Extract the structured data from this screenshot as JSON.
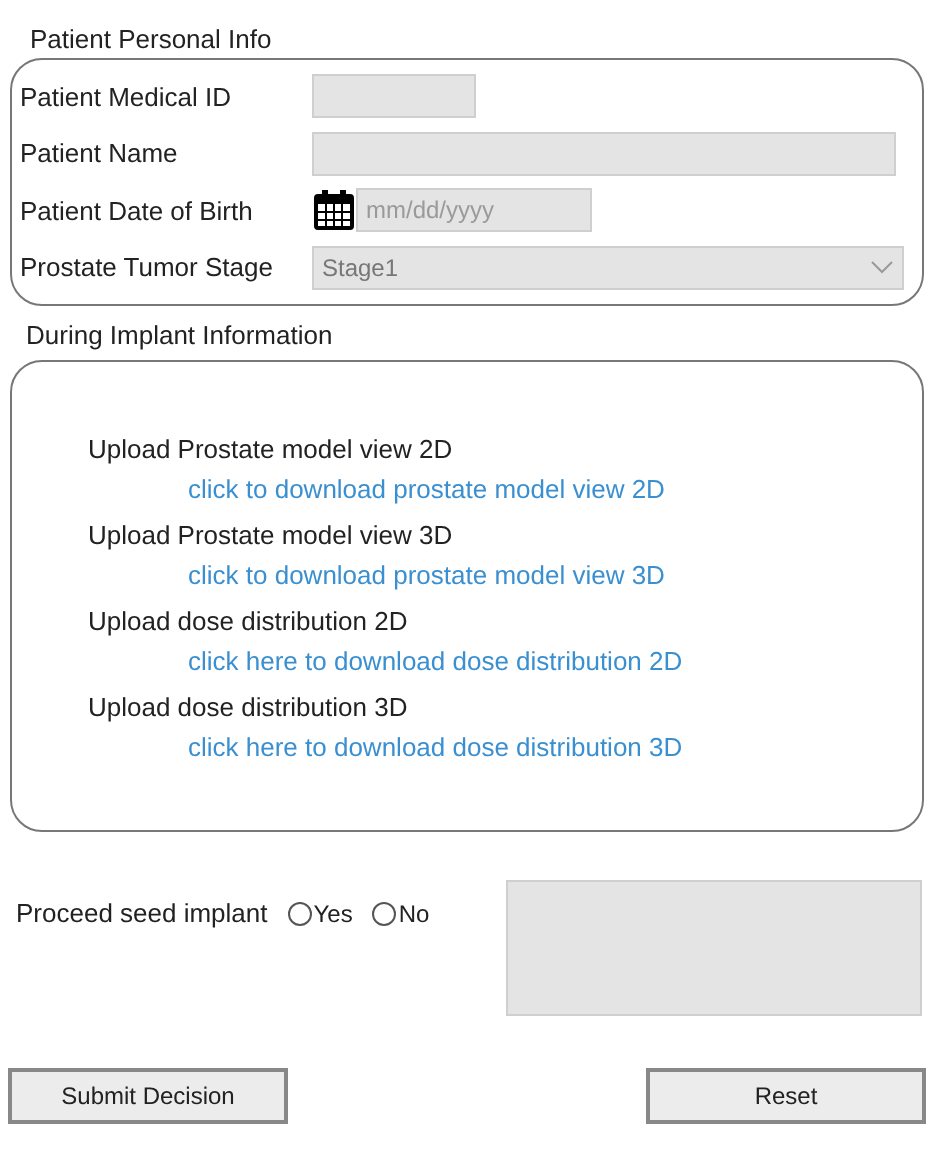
{
  "personal_info": {
    "title": "Patient Personal Info",
    "fields": [
      {
        "kind": "short",
        "label": "Patient Medical ID"
      },
      {
        "kind": "text",
        "label": "Patient Name"
      },
      {
        "kind": "date",
        "label": "Patient Date of Birth",
        "placeholder": "mm/dd/yyyy"
      },
      {
        "kind": "select",
        "label": "Prostate Tumor Stage",
        "value": "Stage1"
      }
    ]
  },
  "implant_info": {
    "title": "During Implant Information",
    "uploads": [
      {
        "label": "Upload Prostate model view 2D",
        "link": "click to download prostate model view 2D"
      },
      {
        "label": "Upload Prostate model view 3D",
        "link": "click to download prostate model view 3D"
      },
      {
        "label": "Upload dose distribution 2D",
        "link": "click here to download dose distribution 2D"
      },
      {
        "label": "Upload dose distribution 3D",
        "link": "click here to download dose distribution 3D"
      }
    ]
  },
  "decision": {
    "label": "Proceed seed implant",
    "options": [
      {
        "label": "Yes",
        "selected": false
      },
      {
        "label": "No",
        "selected": false
      }
    ]
  },
  "buttons": [
    "Submit Decision",
    "Reset"
  ]
}
